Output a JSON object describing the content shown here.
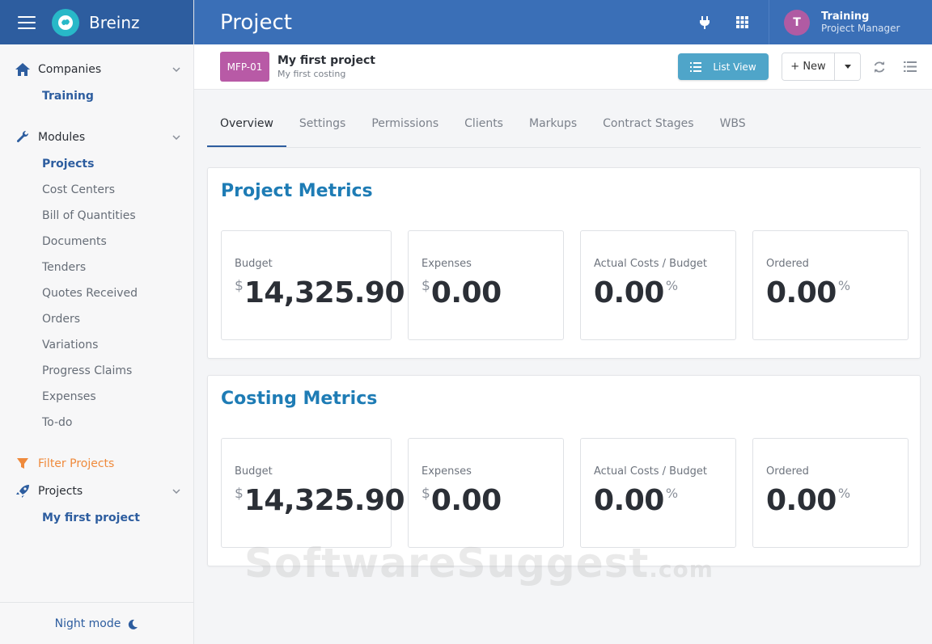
{
  "brand": {
    "name": "Breinz"
  },
  "header": {
    "page_title": "Project",
    "user": {
      "initial": "T",
      "name": "Training",
      "role": "Project Manager"
    }
  },
  "sidebar": {
    "companies": {
      "label": "Companies",
      "items": [
        {
          "label": "Training",
          "active": true
        }
      ]
    },
    "modules": {
      "label": "Modules",
      "items": [
        {
          "label": "Projects",
          "active": true
        },
        {
          "label": "Cost Centers"
        },
        {
          "label": "Bill of Quantities"
        },
        {
          "label": "Documents"
        },
        {
          "label": "Tenders"
        },
        {
          "label": "Quotes Received"
        },
        {
          "label": "Orders"
        },
        {
          "label": "Variations"
        },
        {
          "label": "Progress Claims"
        },
        {
          "label": "Expenses"
        },
        {
          "label": "To-do"
        }
      ]
    },
    "filter_label": "Filter Projects",
    "projects": {
      "label": "Projects",
      "items": [
        {
          "label": "My first project",
          "active": true
        }
      ]
    },
    "night_mode": "Night mode"
  },
  "project": {
    "code": "MFP-01",
    "name": "My first project",
    "subtitle": "My first costing",
    "list_view_label": "List View",
    "new_label": "+ New"
  },
  "tabs": [
    "Overview",
    "Settings",
    "Permissions",
    "Clients",
    "Markups",
    "Contract Stages",
    "WBS"
  ],
  "project_metrics": {
    "title": "Project Metrics",
    "cards": [
      {
        "label": "Budget",
        "prefix": "$",
        "value": "14,325.90",
        "suffix": ""
      },
      {
        "label": "Expenses",
        "prefix": "$",
        "value": "0.00",
        "suffix": ""
      },
      {
        "label": "Actual Costs / Budget",
        "prefix": "",
        "value": "0.00",
        "suffix": "%"
      },
      {
        "label": "Ordered",
        "prefix": "",
        "value": "0.00",
        "suffix": "%"
      }
    ]
  },
  "costing_metrics": {
    "title": "Costing Metrics",
    "cards": [
      {
        "label": "Budget",
        "prefix": "$",
        "value": "14,325.90",
        "suffix": ""
      },
      {
        "label": "Expenses",
        "prefix": "$",
        "value": "0.00",
        "suffix": ""
      },
      {
        "label": "Actual Costs / Budget",
        "prefix": "",
        "value": "0.00",
        "suffix": "%"
      },
      {
        "label": "Ordered",
        "prefix": "",
        "value": "0.00",
        "suffix": "%"
      }
    ]
  },
  "watermark": {
    "main": "SoftwareSuggest",
    "tld": ".com"
  },
  "colors": {
    "sidebar_brand": "#2d5d9f",
    "topbar": "#3a6fb7",
    "accent": "#1e7cb5",
    "project_badge": "#b85aa6",
    "avatar": "#b05ba3",
    "list_view_button": "#4fa5c9",
    "filter_accent": "#ef8a3c"
  },
  "icons": {
    "menu": "hamburger-icon",
    "companies": "home-icon",
    "modules": "wrench-icon",
    "filter": "funnel-icon",
    "projects": "rocket-icon",
    "night": "moon-icon",
    "plug": "plug-icon",
    "apps": "grid-icon",
    "refresh": "refresh-icon",
    "list": "list-icon"
  }
}
